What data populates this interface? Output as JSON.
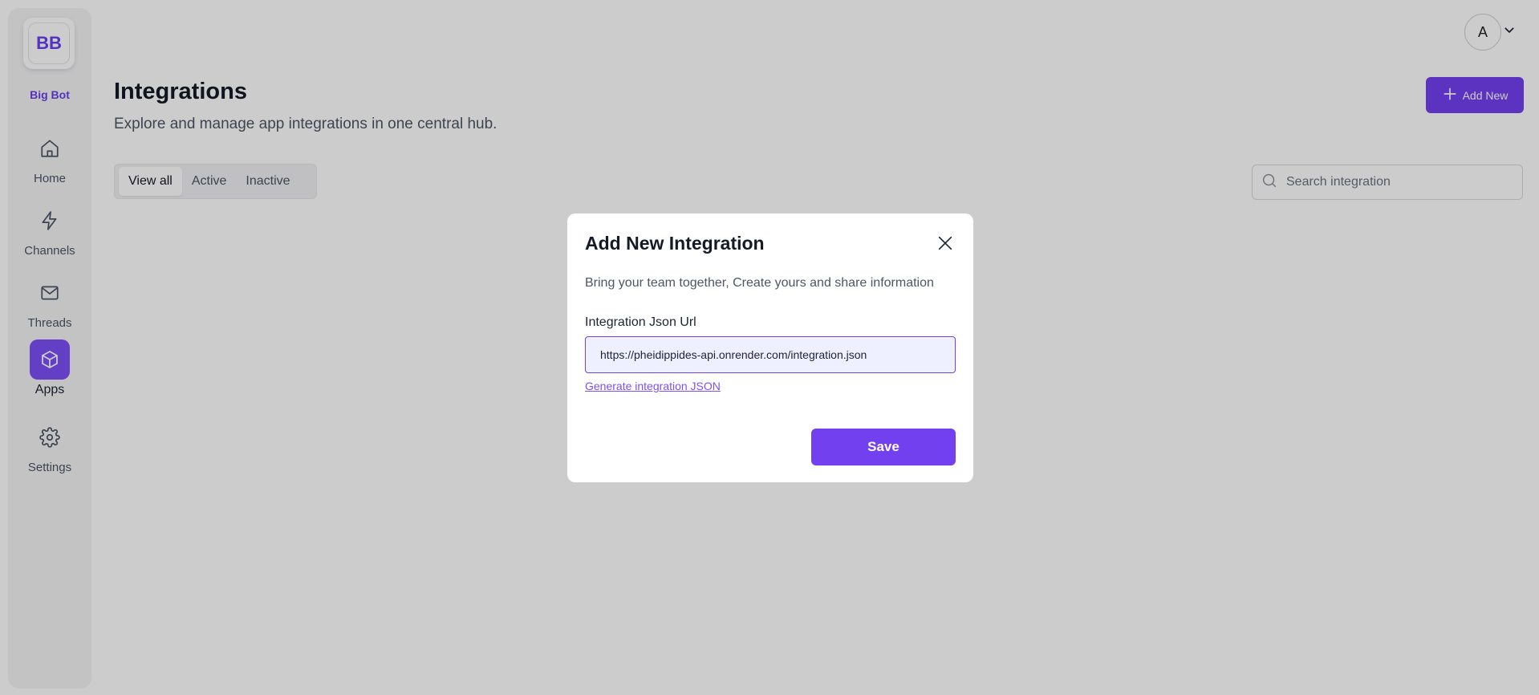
{
  "sidebar": {
    "logo_text": "BB",
    "brand_name": "Big Bot",
    "items": [
      {
        "label": "Home",
        "icon": "home-icon"
      },
      {
        "label": "Channels",
        "icon": "lightning-icon"
      },
      {
        "label": "Threads",
        "icon": "mail-icon"
      },
      {
        "label": "Apps",
        "icon": "cube-icon",
        "active": true
      },
      {
        "label": "Settings",
        "icon": "gear-icon"
      }
    ]
  },
  "header": {
    "avatar_initial": "A",
    "title": "Integrations",
    "subtitle": "Explore and manage app integrations in one central hub.",
    "add_button_label": "Add New"
  },
  "tabs": [
    {
      "label": "View all",
      "active": true
    },
    {
      "label": "Active"
    },
    {
      "label": "Inactive"
    }
  ],
  "search": {
    "placeholder": "Search integration",
    "value": ""
  },
  "modal": {
    "title": "Add New Integration",
    "description": "Bring your team together, Create yours and share information",
    "field_label": "Integration Json Url",
    "field_value": "https://pheidippides-api.onrender.com/integration.json",
    "link_label": "Generate integration JSON",
    "save_label": "Save"
  },
  "colors": {
    "accent": "#7340f0",
    "overlay": "rgba(0,0,0,0.2)"
  }
}
